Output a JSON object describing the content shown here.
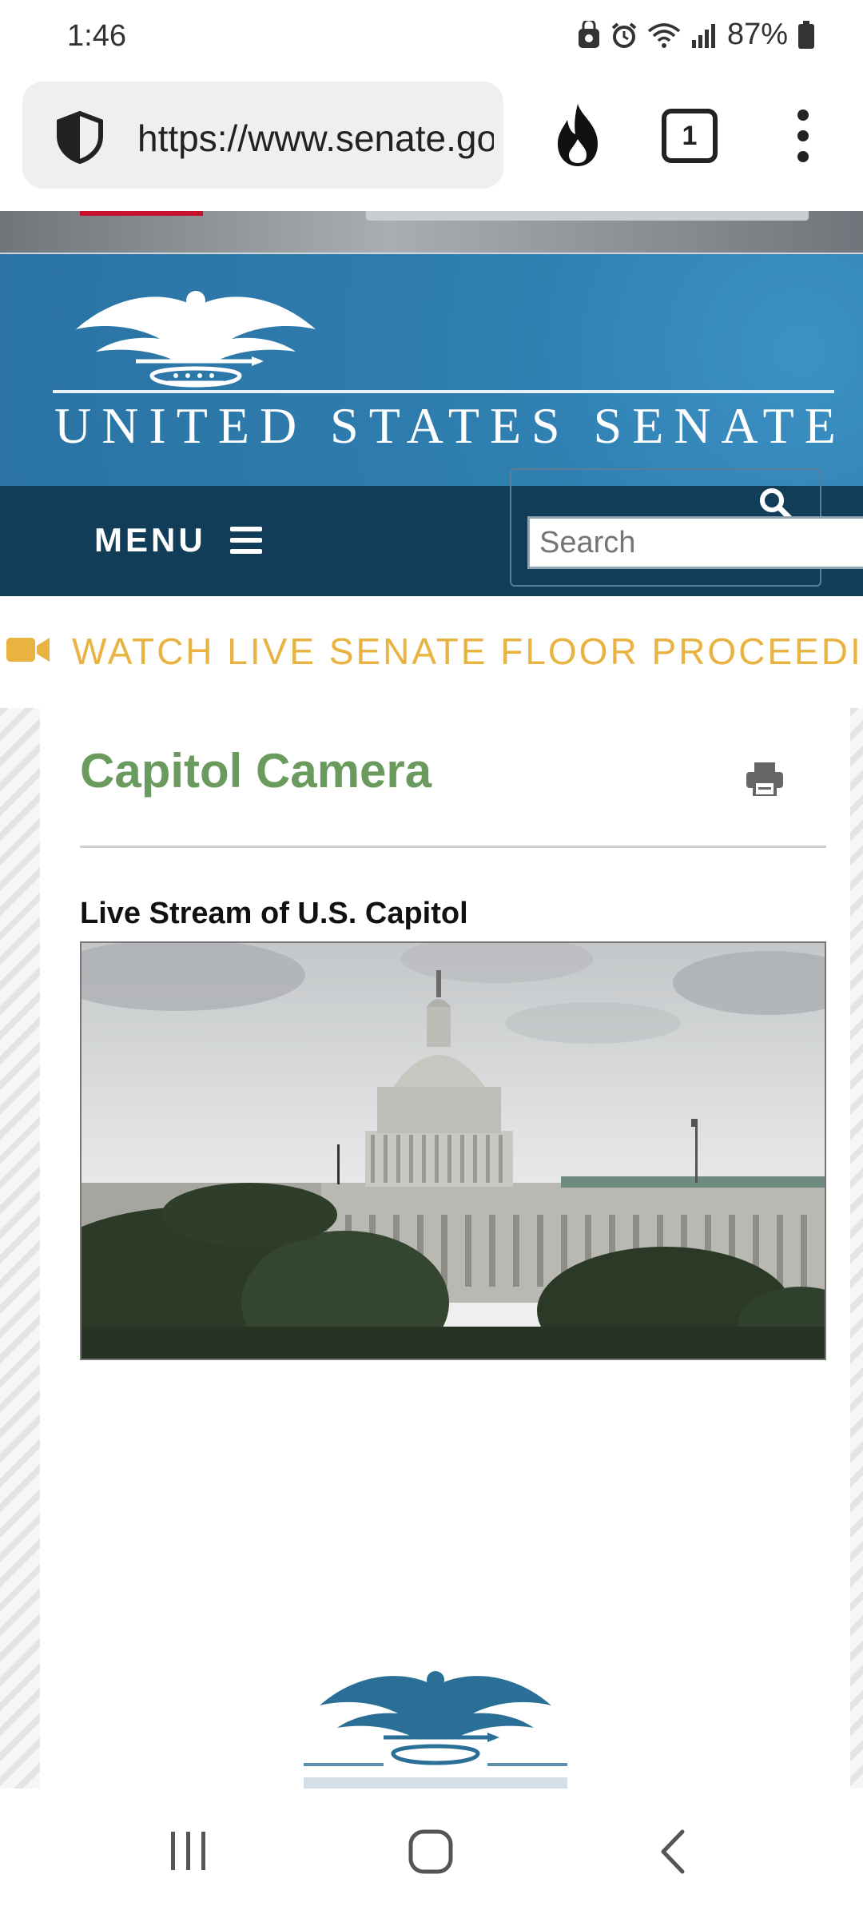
{
  "status": {
    "time": "1:46",
    "battery": "87%"
  },
  "browser": {
    "url": "https://www.senate.gov/general/capitol-camera.htm",
    "tab_count": "1"
  },
  "site": {
    "name": "UNITED STATES SENATE",
    "menu_label": "MENU",
    "search_placeholder": "Search",
    "live_banner": "WATCH LIVE SENATE FLOOR PROCEEDINGS"
  },
  "page": {
    "title": "Capitol Camera",
    "subheading": "Live Stream of U.S. Capitol"
  },
  "colors": {
    "banner_blue": "#2f7fb1",
    "nav_dark": "#123d59",
    "title_green": "#6a9a5d",
    "live_gold": "#e8b340"
  },
  "icons": [
    "shield-icon",
    "fire-icon",
    "tabs-icon",
    "kebab-menu-icon",
    "hamburger-icon",
    "search-icon",
    "video-camera-icon",
    "print-icon",
    "recents-icon",
    "home-icon",
    "back-icon"
  ]
}
